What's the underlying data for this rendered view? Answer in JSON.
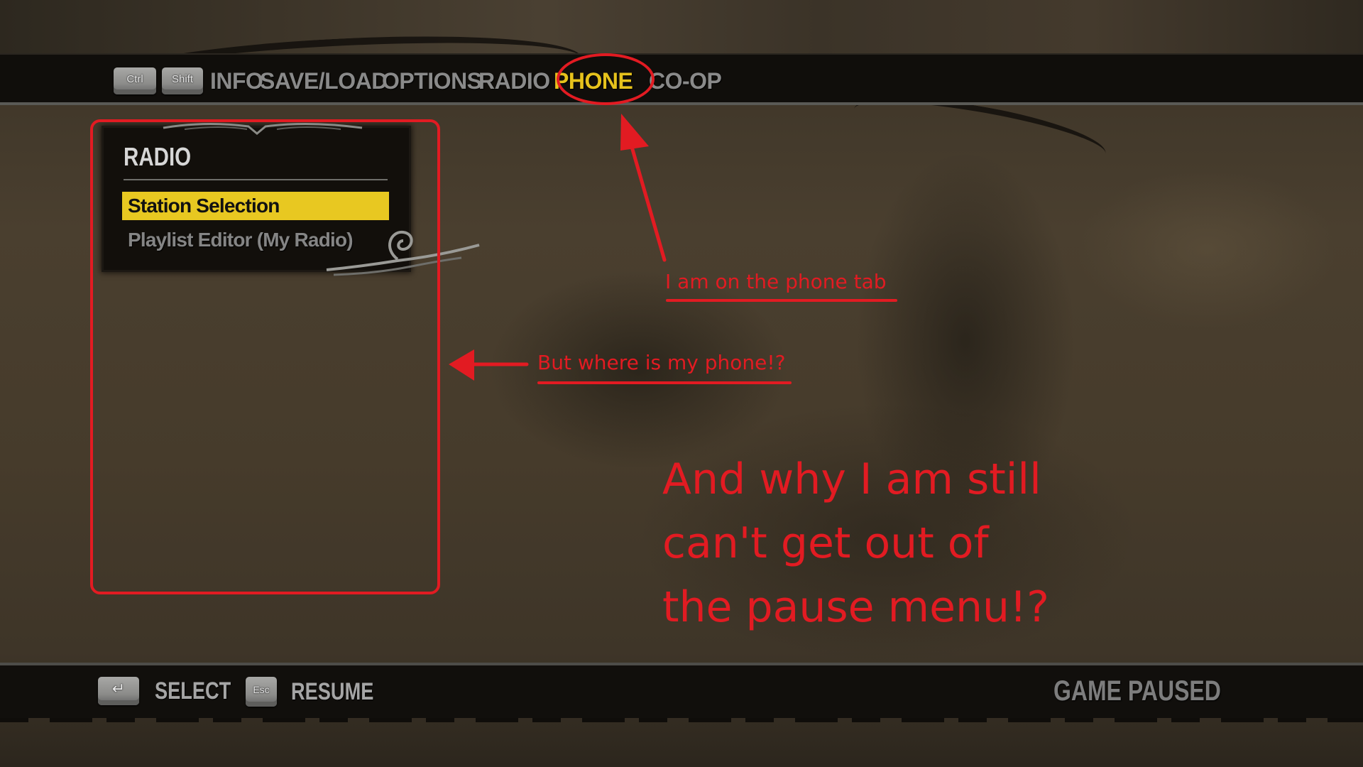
{
  "top_nav": {
    "modifier_keys": [
      {
        "label": "Ctrl"
      },
      {
        "label": "Shift"
      }
    ],
    "tabs": [
      {
        "label": "INFO",
        "active": false
      },
      {
        "label": "SAVE/LOAD",
        "active": false
      },
      {
        "label": "OPTIONS",
        "active": false
      },
      {
        "label": "RADIO",
        "active": false
      },
      {
        "label": "PHONE",
        "active": true
      },
      {
        "label": "CO-OP",
        "active": false
      }
    ]
  },
  "panel": {
    "title": "RADIO",
    "items": [
      {
        "label": "Station Selection",
        "selected": true
      },
      {
        "label": "Playlist Editor (My Radio)",
        "selected": false
      }
    ]
  },
  "bottom_bar": {
    "hints": [
      {
        "key": "↵",
        "key_name": "enter-key",
        "label": "SELECT"
      },
      {
        "key": "Esc",
        "key_name": "esc-key",
        "label": "RESUME"
      }
    ],
    "status": "GAME PAUSED"
  },
  "annotations": {
    "phone_tab_note": "I am on the phone tab",
    "where_phone_note": "But where is my phone!?",
    "pause_menu_note": "And why I am still can't get out of the pause menu!?",
    "color": "#e21b22"
  },
  "colors": {
    "active_tab": "#e6c21c",
    "inactive_tab": "#8a8a8a",
    "selected_item_bg": "#e8c821"
  }
}
